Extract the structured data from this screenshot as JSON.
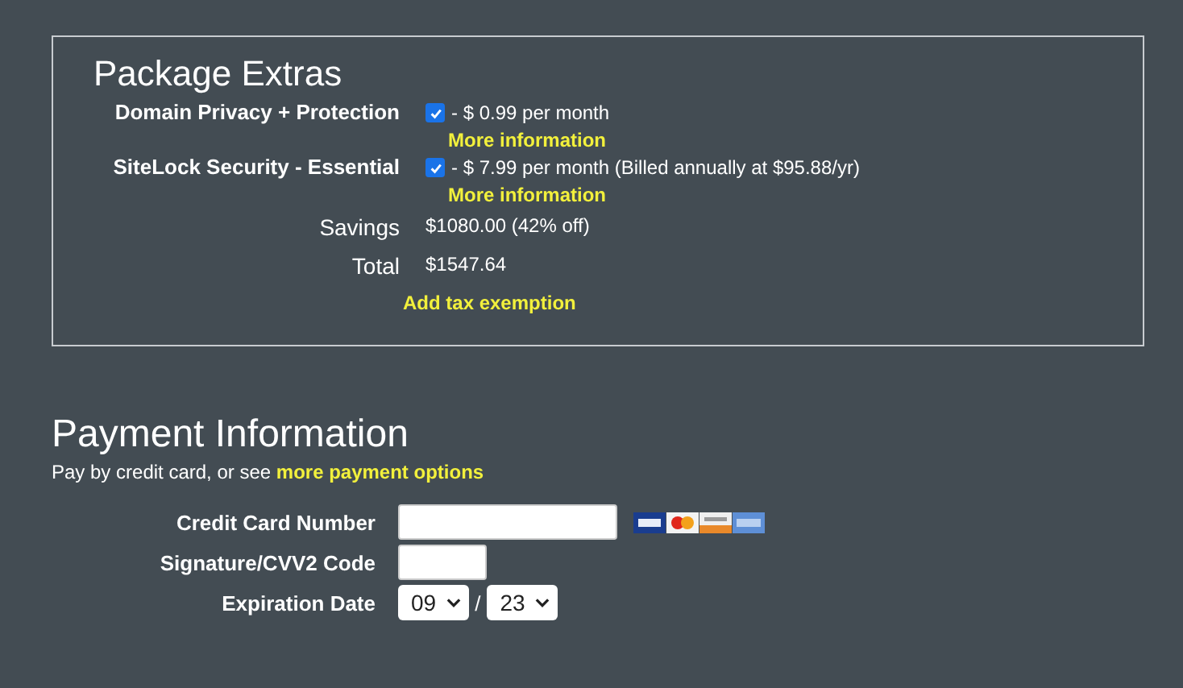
{
  "package_extras": {
    "title": "Package Extras",
    "items": [
      {
        "label": "Domain Privacy + Protection",
        "checked": true,
        "price": "- $ 0.99 per month",
        "link": "More information"
      },
      {
        "label": "SiteLock Security - Essential",
        "checked": true,
        "price": "- $ 7.99 per month (Billed annually at $95.88/yr)",
        "link": "More information"
      }
    ],
    "summary": [
      {
        "label": "Savings",
        "value": "$1080.00 (42% off)"
      },
      {
        "label": "Total",
        "value": "$1547.64"
      }
    ],
    "tax_link": "Add tax exemption"
  },
  "payment": {
    "title": "Payment Information",
    "intro": "Pay by credit card, or see **more payment options**",
    "card_number": {
      "label": "Credit Card Number"
    },
    "cvv": {
      "label": "Signature/CVV2 Code"
    },
    "expiration": {
      "label": "Expiration Date",
      "month": "09",
      "separator": "/",
      "year": "23"
    }
  }
}
